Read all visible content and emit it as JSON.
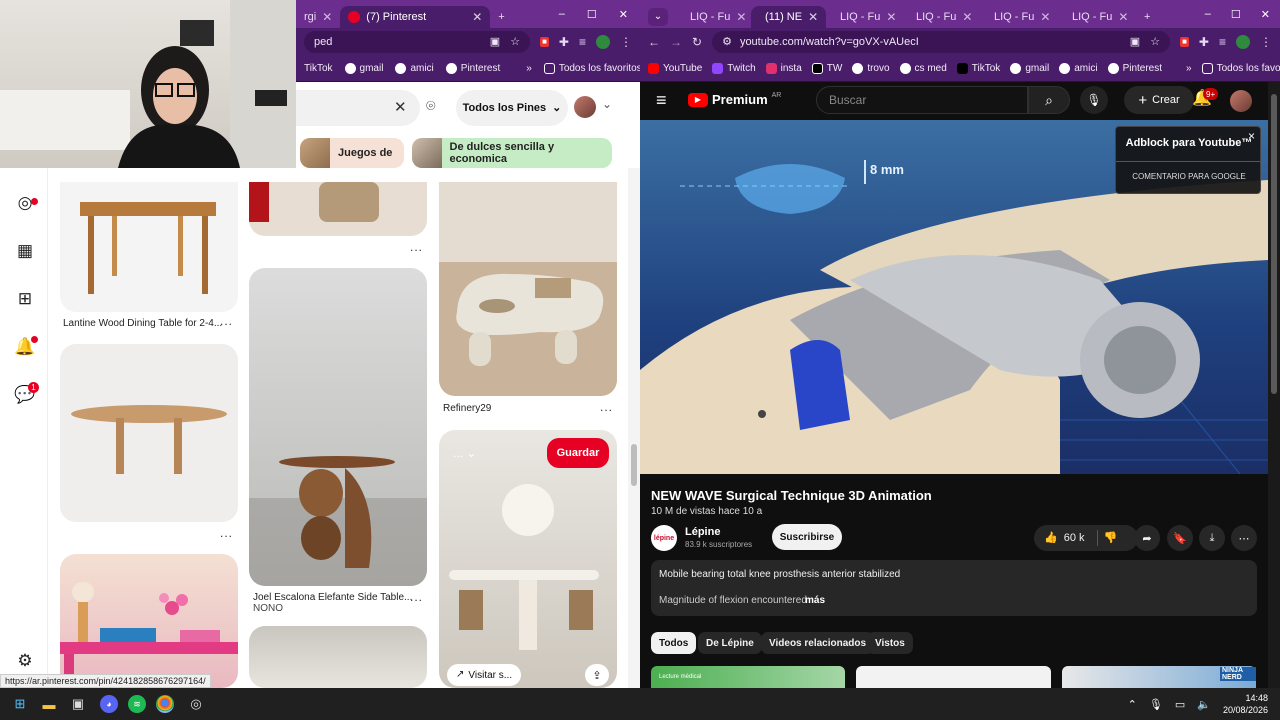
{
  "left_browser": {
    "tabs": [
      {
        "label": "rgi",
        "active": false
      },
      {
        "label": "(7) Pinterest",
        "active": true
      }
    ],
    "new_tab": "+",
    "window_controls": [
      "–",
      "☐",
      "✕"
    ],
    "address": "ped",
    "bookmarks": [
      "TikTok",
      "gmail",
      "amici",
      "Pinterest"
    ],
    "bookmarks_overflow": "»",
    "all_bookmarks": "Todos los favoritos"
  },
  "pinterest": {
    "filter_label": "Todos los Pines",
    "chips": [
      "Juegos de",
      "De dulces sencilla y economica"
    ],
    "notification_badge": "1",
    "pins": {
      "col1_a_caption": "Lantine Wood Dining Table for 2-4...",
      "col3_a_caption": "Refinery29",
      "col2_b_caption": "Joel Escalona Elefante Side Table...",
      "col2_b_sub": "NONO",
      "save_button": "Guardar",
      "visit_button": "Visitar s...",
      "more": "..."
    },
    "status_url": "https://ar.pinterest.com/pin/4241828586762971​64/"
  },
  "right_browser": {
    "tabs": [
      {
        "label": "LIQ - Fu",
        "active": false
      },
      {
        "label": "(11) NE",
        "active": true
      },
      {
        "label": "LIQ - Fu",
        "active": false
      },
      {
        "label": "LIQ - Fu",
        "active": false
      },
      {
        "label": "LIQ - Fu",
        "active": false
      },
      {
        "label": "LIQ - Fu",
        "active": false
      }
    ],
    "new_tab": "+",
    "window_controls": [
      "–",
      "☐",
      "✕"
    ],
    "address": "youtube.com/watch?v=goVX-vAUecI",
    "bookmarks": [
      "YouTube",
      "Twitch",
      "insta",
      "TW",
      "trovo",
      "cs med",
      "TikTok",
      "gmail",
      "amici",
      "Pinterest"
    ],
    "bookmarks_overflow": "»",
    "all_bookmarks": "Todos los favoritos"
  },
  "youtube": {
    "logo": "Premium",
    "logo_region": "AR",
    "search_placeholder": "Buscar",
    "create_label": "Crear",
    "notif_badge": "9+",
    "adblock_title": "Adblock para Youtube™",
    "adblock_close": "×",
    "adblock_comment": "COMENTARIO PARA GOOGLE",
    "video_annotation": "8 mm",
    "video_title": "NEW WAVE Surgical Technique 3D Animation",
    "video_meta": "10 M de vistas  hace 10 a",
    "channel_name": "Lépine",
    "channel_subs": "83.9 k suscriptores",
    "channel_logo_text": "lépine",
    "subscribe_label": "Suscribirse",
    "like_count": "60 k",
    "description_line1": "Mobile bearing total knee prosthesis anterior stabilized",
    "description_line2": "Magnitude of flexion encountered",
    "description_more": "más",
    "filter_chips": [
      "Todos",
      "De Lépine",
      "Videos relacionados",
      "Vistos"
    ],
    "thumb_text": "Lecture médical",
    "thumb3_text": "NINJA NERD"
  },
  "taskbar": {
    "time": "14:48",
    "date": "20/08/2026"
  },
  "colors": {
    "browser_purple": "#6b2d8e",
    "pinterest_red": "#e60023",
    "youtube_bg": "#0f0f0f",
    "youtube_red": "#ff0000"
  }
}
